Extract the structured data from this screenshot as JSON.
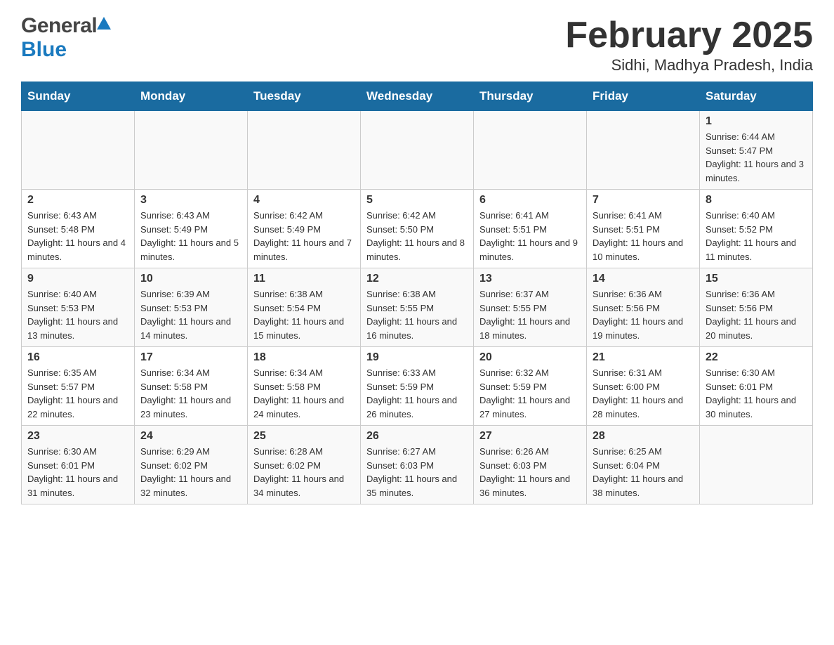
{
  "header": {
    "logo_general": "General",
    "logo_blue": "Blue",
    "title": "February 2025",
    "subtitle": "Sidhi, Madhya Pradesh, India"
  },
  "days_of_week": [
    "Sunday",
    "Monday",
    "Tuesday",
    "Wednesday",
    "Thursday",
    "Friday",
    "Saturday"
  ],
  "weeks": [
    [
      {
        "day": "",
        "info": ""
      },
      {
        "day": "",
        "info": ""
      },
      {
        "day": "",
        "info": ""
      },
      {
        "day": "",
        "info": ""
      },
      {
        "day": "",
        "info": ""
      },
      {
        "day": "",
        "info": ""
      },
      {
        "day": "1",
        "info": "Sunrise: 6:44 AM\nSunset: 5:47 PM\nDaylight: 11 hours and 3 minutes."
      }
    ],
    [
      {
        "day": "2",
        "info": "Sunrise: 6:43 AM\nSunset: 5:48 PM\nDaylight: 11 hours and 4 minutes."
      },
      {
        "day": "3",
        "info": "Sunrise: 6:43 AM\nSunset: 5:49 PM\nDaylight: 11 hours and 5 minutes."
      },
      {
        "day": "4",
        "info": "Sunrise: 6:42 AM\nSunset: 5:49 PM\nDaylight: 11 hours and 7 minutes."
      },
      {
        "day": "5",
        "info": "Sunrise: 6:42 AM\nSunset: 5:50 PM\nDaylight: 11 hours and 8 minutes."
      },
      {
        "day": "6",
        "info": "Sunrise: 6:41 AM\nSunset: 5:51 PM\nDaylight: 11 hours and 9 minutes."
      },
      {
        "day": "7",
        "info": "Sunrise: 6:41 AM\nSunset: 5:51 PM\nDaylight: 11 hours and 10 minutes."
      },
      {
        "day": "8",
        "info": "Sunrise: 6:40 AM\nSunset: 5:52 PM\nDaylight: 11 hours and 11 minutes."
      }
    ],
    [
      {
        "day": "9",
        "info": "Sunrise: 6:40 AM\nSunset: 5:53 PM\nDaylight: 11 hours and 13 minutes."
      },
      {
        "day": "10",
        "info": "Sunrise: 6:39 AM\nSunset: 5:53 PM\nDaylight: 11 hours and 14 minutes."
      },
      {
        "day": "11",
        "info": "Sunrise: 6:38 AM\nSunset: 5:54 PM\nDaylight: 11 hours and 15 minutes."
      },
      {
        "day": "12",
        "info": "Sunrise: 6:38 AM\nSunset: 5:55 PM\nDaylight: 11 hours and 16 minutes."
      },
      {
        "day": "13",
        "info": "Sunrise: 6:37 AM\nSunset: 5:55 PM\nDaylight: 11 hours and 18 minutes."
      },
      {
        "day": "14",
        "info": "Sunrise: 6:36 AM\nSunset: 5:56 PM\nDaylight: 11 hours and 19 minutes."
      },
      {
        "day": "15",
        "info": "Sunrise: 6:36 AM\nSunset: 5:56 PM\nDaylight: 11 hours and 20 minutes."
      }
    ],
    [
      {
        "day": "16",
        "info": "Sunrise: 6:35 AM\nSunset: 5:57 PM\nDaylight: 11 hours and 22 minutes."
      },
      {
        "day": "17",
        "info": "Sunrise: 6:34 AM\nSunset: 5:58 PM\nDaylight: 11 hours and 23 minutes."
      },
      {
        "day": "18",
        "info": "Sunrise: 6:34 AM\nSunset: 5:58 PM\nDaylight: 11 hours and 24 minutes."
      },
      {
        "day": "19",
        "info": "Sunrise: 6:33 AM\nSunset: 5:59 PM\nDaylight: 11 hours and 26 minutes."
      },
      {
        "day": "20",
        "info": "Sunrise: 6:32 AM\nSunset: 5:59 PM\nDaylight: 11 hours and 27 minutes."
      },
      {
        "day": "21",
        "info": "Sunrise: 6:31 AM\nSunset: 6:00 PM\nDaylight: 11 hours and 28 minutes."
      },
      {
        "day": "22",
        "info": "Sunrise: 6:30 AM\nSunset: 6:01 PM\nDaylight: 11 hours and 30 minutes."
      }
    ],
    [
      {
        "day": "23",
        "info": "Sunrise: 6:30 AM\nSunset: 6:01 PM\nDaylight: 11 hours and 31 minutes."
      },
      {
        "day": "24",
        "info": "Sunrise: 6:29 AM\nSunset: 6:02 PM\nDaylight: 11 hours and 32 minutes."
      },
      {
        "day": "25",
        "info": "Sunrise: 6:28 AM\nSunset: 6:02 PM\nDaylight: 11 hours and 34 minutes."
      },
      {
        "day": "26",
        "info": "Sunrise: 6:27 AM\nSunset: 6:03 PM\nDaylight: 11 hours and 35 minutes."
      },
      {
        "day": "27",
        "info": "Sunrise: 6:26 AM\nSunset: 6:03 PM\nDaylight: 11 hours and 36 minutes."
      },
      {
        "day": "28",
        "info": "Sunrise: 6:25 AM\nSunset: 6:04 PM\nDaylight: 11 hours and 38 minutes."
      },
      {
        "day": "",
        "info": ""
      }
    ]
  ]
}
